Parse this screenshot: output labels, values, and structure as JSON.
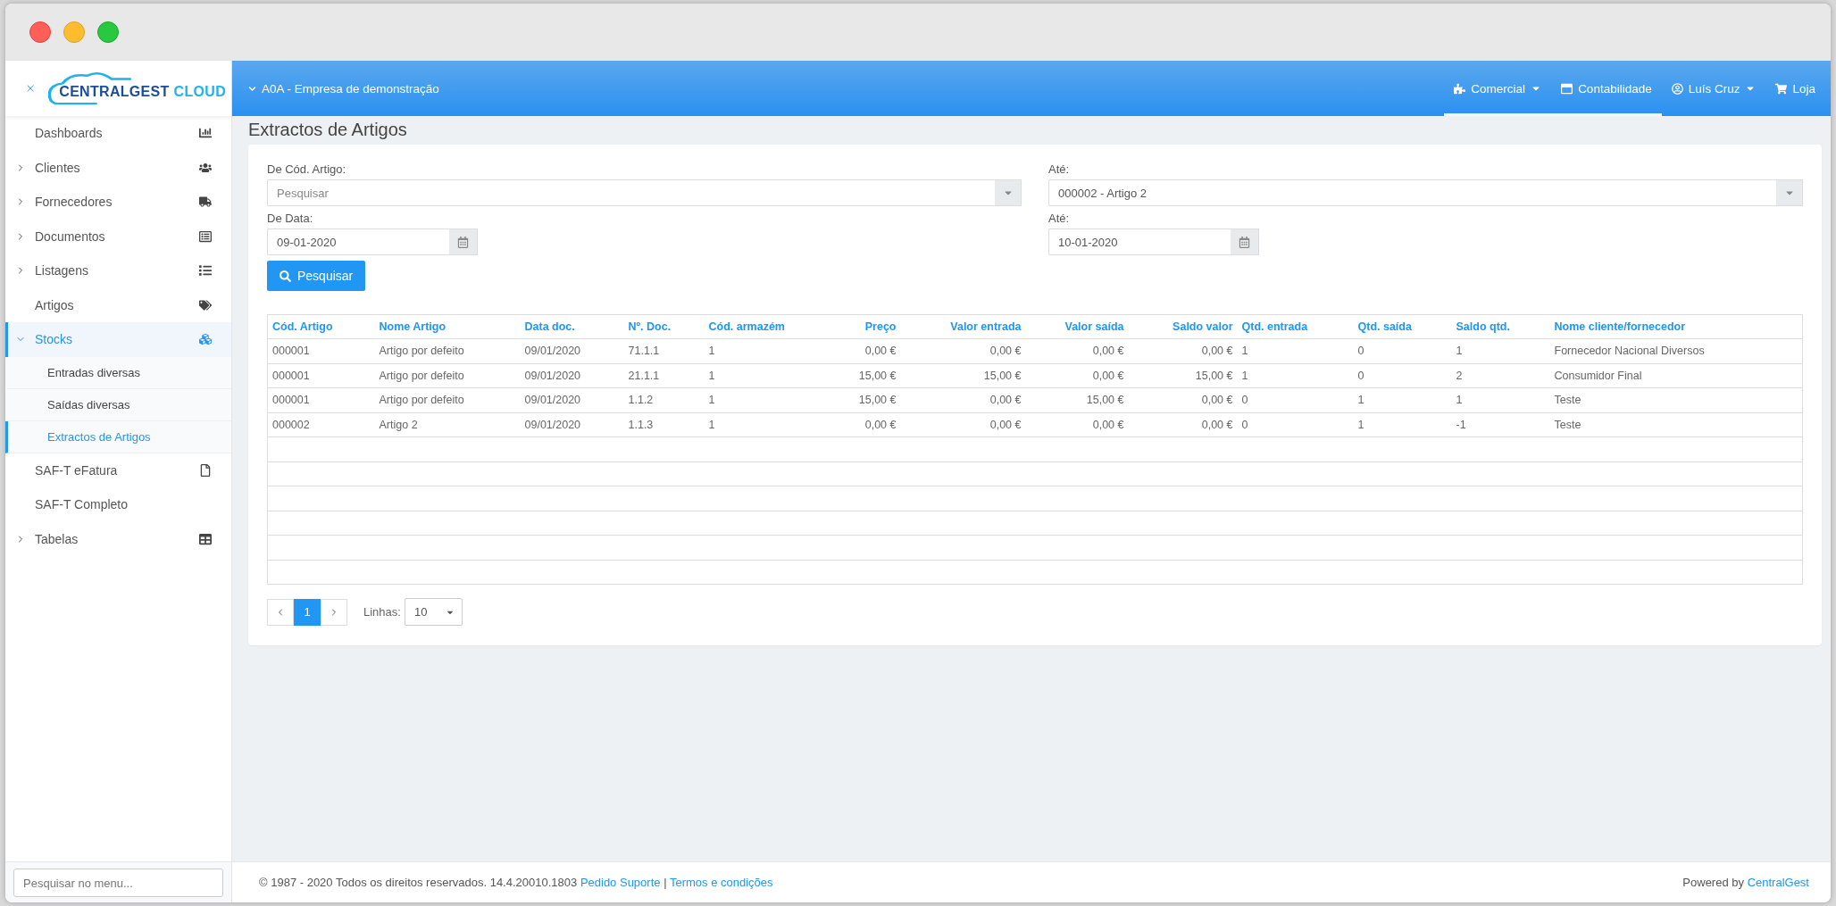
{
  "sidebar": {
    "logo": {
      "primary": "CENTRALGEST",
      "secondary": "CLOUD"
    },
    "items": [
      {
        "label": "Dashboards",
        "expandable": false,
        "expanded": false,
        "selected": false
      },
      {
        "label": "Clientes",
        "expandable": true,
        "expanded": false,
        "selected": false
      },
      {
        "label": "Fornecedores",
        "expandable": true,
        "expanded": false,
        "selected": false
      },
      {
        "label": "Documentos",
        "expandable": true,
        "expanded": false,
        "selected": false
      },
      {
        "label": "Listagens",
        "expandable": true,
        "expanded": false,
        "selected": false
      },
      {
        "label": "Artigos",
        "expandable": false,
        "expanded": false,
        "selected": false
      },
      {
        "label": "Stocks",
        "expandable": true,
        "expanded": true,
        "selected": true,
        "children": [
          {
            "label": "Entradas diversas",
            "selected": false
          },
          {
            "label": "Saídas diversas",
            "selected": false
          },
          {
            "label": "Extractos de Artigos",
            "selected": true
          }
        ]
      },
      {
        "label": "SAF-T eFatura",
        "expandable": false,
        "expanded": false,
        "selected": false
      },
      {
        "label": "SAF-T Completo",
        "expandable": false,
        "expanded": false,
        "selected": false
      },
      {
        "label": "Tabelas",
        "expandable": true,
        "expanded": false,
        "selected": false
      }
    ],
    "search": {
      "placeholder": "Pesquisar no menu..."
    }
  },
  "topbar": {
    "company": "A0A - Empresa de demonstração",
    "nav": [
      {
        "label": "Comercial",
        "dropdown": true,
        "selected": true
      },
      {
        "label": "Contabilidade",
        "dropdown": false,
        "selected": true
      },
      {
        "label": "Luís Cruz",
        "dropdown": true,
        "selected": false
      },
      {
        "label": "Loja",
        "dropdown": false,
        "selected": false
      }
    ]
  },
  "page": {
    "title": "Extractos de Artigos"
  },
  "filters": [
    {
      "label": "De Cód. Artigo:",
      "kind": "select",
      "placeholder": "Pesquisar"
    },
    {
      "label": "Até:",
      "kind": "select",
      "value": "000002 - Artigo 2"
    },
    {
      "label": "De Data:",
      "kind": "date",
      "value": "09-01-2020"
    },
    {
      "label": "Até:",
      "kind": "date",
      "value": "10-01-2020"
    }
  ],
  "search_button": "Pesquisar",
  "table": {
    "columns": [
      {
        "label": "Cód. Artigo",
        "kind": "text"
      },
      {
        "label": "Nome Artigo",
        "kind": "text"
      },
      {
        "label": "Data doc.",
        "kind": "text"
      },
      {
        "label": "Nº. Doc.",
        "kind": "text"
      },
      {
        "label": "Cód. armazém",
        "kind": "text"
      },
      {
        "label": "Preço",
        "kind": "amount"
      },
      {
        "label": "Valor entrada",
        "kind": "amount"
      },
      {
        "label": "Valor saída",
        "kind": "amount"
      },
      {
        "label": "Saldo valor",
        "kind": "amount"
      },
      {
        "label": "Qtd. entrada",
        "kind": "text"
      },
      {
        "label": "Qtd. saída",
        "kind": "text"
      },
      {
        "label": "Saldo qtd.",
        "kind": "text"
      },
      {
        "label": "Nome cliente/fornecedor",
        "kind": "text"
      }
    ],
    "rows": [
      [
        "000001",
        "Artigo por defeito",
        "09/01/2020",
        "71.1.1",
        "1",
        "0,00 €",
        "0,00 €",
        "0,00 €",
        "0,00 €",
        "1",
        "0",
        "1",
        "Fornecedor Nacional Diversos"
      ],
      [
        "000001",
        "Artigo por defeito",
        "09/01/2020",
        "21.1.1",
        "1",
        "15,00 €",
        "15,00 €",
        "0,00 €",
        "15,00 €",
        "1",
        "0",
        "2",
        "Consumidor Final"
      ],
      [
        "000001",
        "Artigo por defeito",
        "09/01/2020",
        "1.1.2",
        "1",
        "15,00 €",
        "0,00 €",
        "15,00 €",
        "0,00 €",
        "0",
        "1",
        "1",
        "Teste"
      ],
      [
        "000002",
        "Artigo 2",
        "09/01/2020",
        "1.1.3",
        "1",
        "0,00 €",
        "0,00 €",
        "0,00 €",
        "0,00 €",
        "0",
        "1",
        "-1",
        "Teste"
      ]
    ]
  },
  "pagination": {
    "pages": [
      {
        "label": "1",
        "selected": true
      }
    ],
    "rows_label": "Linhas:",
    "rows_value": "10"
  },
  "footer": {
    "text": "© 1987 - 2020 Todos os direitos reservados. 14.4.20010.1803",
    "links": [
      "Pedido Suporte",
      "Termos e condições"
    ],
    "separator": "|",
    "powered_by": "Powered by",
    "brand": "CentralGest"
  }
}
